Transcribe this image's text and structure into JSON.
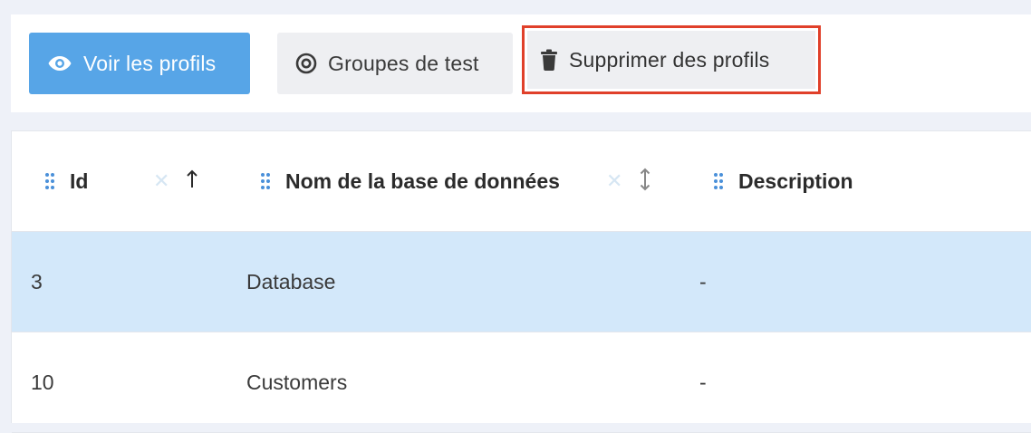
{
  "toolbar": {
    "view_profiles_label": "Voir les profils",
    "test_groups_label": "Groupes de test",
    "delete_profiles_label": "Supprimer des profils"
  },
  "table": {
    "columns": [
      {
        "label": "Id",
        "sort": "ascending"
      },
      {
        "label": "Nom de la base de données",
        "sort": "none"
      },
      {
        "label": "Description",
        "sort": null
      }
    ],
    "rows": [
      {
        "id": "3",
        "name": "Database",
        "description": "-",
        "selected": true
      },
      {
        "id": "10",
        "name": "Customers",
        "description": "-",
        "selected": false
      }
    ]
  },
  "colors": {
    "primary": "#57a5e7",
    "highlight_border": "#e0402a",
    "selected_row": "#d3e8fa",
    "drag_handle": "#4a90d9"
  },
  "icons": {
    "view": "eye-icon",
    "groups": "target-icon",
    "delete": "trash-icon",
    "drag": "drag-handle-icon",
    "clear": "clear-x-icon",
    "sort_asc": "arrow-up-icon",
    "sort_none": "arrow-up-down-icon"
  }
}
